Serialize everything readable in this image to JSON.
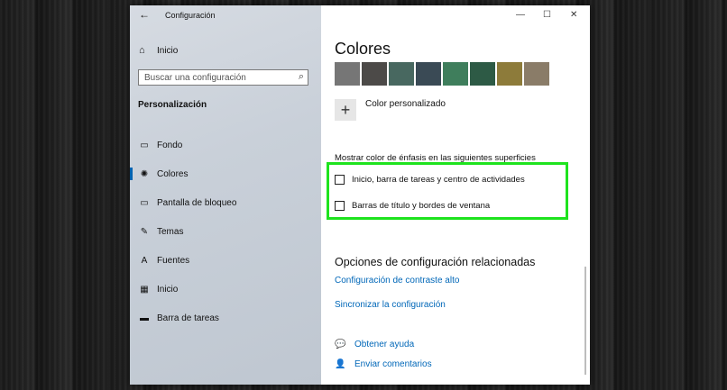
{
  "titlebar": {
    "back_icon": "←",
    "title": "Configuración"
  },
  "sidebar": {
    "home": {
      "icon": "⌂",
      "label": "Inicio"
    },
    "search": {
      "placeholder": "Buscar una configuración",
      "icon": "⌕"
    },
    "section_title": "Personalización",
    "items": [
      {
        "icon": "▭",
        "label": "Fondo",
        "active": false
      },
      {
        "icon": "✺",
        "label": "Colores",
        "active": true
      },
      {
        "icon": "▭",
        "label": "Pantalla de bloqueo",
        "active": false
      },
      {
        "icon": "✎",
        "label": "Temas",
        "active": false
      },
      {
        "icon": "A",
        "label": "Fuentes",
        "active": false
      },
      {
        "icon": "▦",
        "label": "Inicio",
        "active": false
      },
      {
        "icon": "▬",
        "label": "Barra de tareas",
        "active": false
      }
    ]
  },
  "window_controls": {
    "minimize": "—",
    "maximize": "☐",
    "close": "✕"
  },
  "content": {
    "heading": "Colores",
    "swatches": [
      "#767676",
      "#4c4a48",
      "#486860",
      "#3a4a55",
      "#3f7e5c",
      "#2d5a45",
      "#8d7b3a",
      "#8a7c68"
    ],
    "custom_icon": "+",
    "custom_label": "Color personalizado",
    "accent_label": "Mostrar color de énfasis en las siguientes superficies",
    "checkbox_start": "Inicio, barra de tareas y centro de actividades",
    "checkbox_title": "Barras de título y bordes de ventana",
    "related_heading": "Opciones de configuración relacionadas",
    "link_contrast": "Configuración de contraste alto",
    "link_sync": "Sincronizar la configuración",
    "help_icon": "💬",
    "help_label": "Obtener ayuda",
    "feedback_icon": "👤",
    "feedback_label": "Enviar comentarios"
  },
  "colors": {
    "accent": "#0067b8",
    "highlight": "#1ee31e"
  }
}
